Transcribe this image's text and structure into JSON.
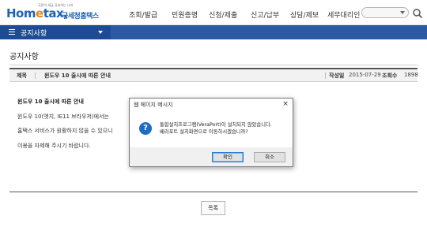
{
  "header": {
    "logo_tagline": "국민이 세금 공부하는 나라",
    "logo_brand_a": "Hom",
    "logo_brand_e": "e",
    "logo_brand_b": "tax,",
    "logo_suffix": "국세청홈택스",
    "nav": [
      "조회/발급",
      "민원증명",
      "신청/제출",
      "신고/납부",
      "상담/제보",
      "세무대리인"
    ]
  },
  "subnav": {
    "label": "공지사항"
  },
  "page": {
    "title": "공지사항"
  },
  "notice": {
    "subject_label": "제목",
    "subject": "윈도우 10 출시에 따른 안내",
    "date_label": "작성일",
    "date": "2015-07-29",
    "views_label": "조회수",
    "views": "1898",
    "body": [
      "윈도우 10 출시에 따른 안내",
      "윈도우 10(엣지, IE11 브라우저)에서는",
      "홈택스 서비스가 원활하지 않을 수 있으니",
      "이용을 자제해 주시기 바랍니다."
    ],
    "list_button": "목록"
  },
  "dialog": {
    "title": "웹 페이지 메시지",
    "close_glyph": "×",
    "icon_glyph": "?",
    "message_line1": "통합설치프로그램(VeraPort)이 설치되지 않았습니다.",
    "message_line2": "베라포트 설치화면으로 이동하시겠습니까?",
    "ok_label": "확인",
    "cancel_label": "취소"
  },
  "colors": {
    "brand_blue": "#1e63b8",
    "brand_orange": "#e38a15",
    "subnav_blue": "#2a5aa4",
    "dialog_icon": "#1f6cc6"
  }
}
